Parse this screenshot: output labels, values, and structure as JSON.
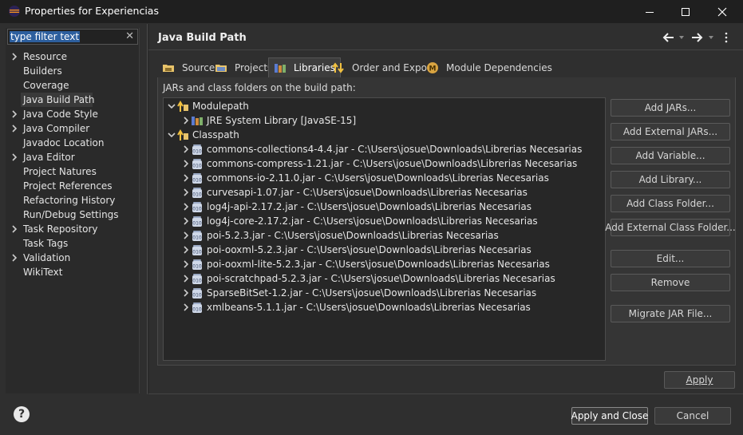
{
  "window": {
    "title": "Properties for Experiencias",
    "minimize_icon": "minimize-icon",
    "maximize_icon": "maximize-icon",
    "close_icon": "close-icon"
  },
  "filter": {
    "value": "type filter text"
  },
  "nav": {
    "items": [
      {
        "label": "Resource",
        "expandable": true
      },
      {
        "label": "Builders",
        "expandable": false
      },
      {
        "label": "Coverage",
        "expandable": false
      },
      {
        "label": "Java Build Path",
        "expandable": false,
        "selected": true
      },
      {
        "label": "Java Code Style",
        "expandable": true
      },
      {
        "label": "Java Compiler",
        "expandable": true
      },
      {
        "label": "Javadoc Location",
        "expandable": false
      },
      {
        "label": "Java Editor",
        "expandable": true
      },
      {
        "label": "Project Natures",
        "expandable": false
      },
      {
        "label": "Project References",
        "expandable": false
      },
      {
        "label": "Refactoring History",
        "expandable": false
      },
      {
        "label": "Run/Debug Settings",
        "expandable": false
      },
      {
        "label": "Task Repository",
        "expandable": true
      },
      {
        "label": "Task Tags",
        "expandable": false
      },
      {
        "label": "Validation",
        "expandable": true
      },
      {
        "label": "WikiText",
        "expandable": false
      }
    ]
  },
  "page": {
    "title": "Java Build Path"
  },
  "tabs": [
    {
      "label": "Source",
      "icon": "source-folder-icon"
    },
    {
      "label": "Projects",
      "icon": "projects-icon"
    },
    {
      "label": "Libraries",
      "icon": "libraries-icon",
      "active": true
    },
    {
      "label": "Order and Export",
      "icon": "order-export-icon"
    },
    {
      "label": "Module Dependencies",
      "icon": "module-icon"
    }
  ],
  "panel": {
    "label": "JARs and class folders on the build path:"
  },
  "tree": {
    "modulepath": {
      "label": "Modulepath",
      "children": [
        "JRE System Library [JavaSE-15]"
      ]
    },
    "classpath": {
      "label": "Classpath",
      "children": [
        "commons-collections4-4.4.jar - C:\\Users\\josue\\Downloads\\Librerias Necesarias",
        "commons-compress-1.21.jar - C:\\Users\\josue\\Downloads\\Librerias Necesarias",
        "commons-io-2.11.0.jar - C:\\Users\\josue\\Downloads\\Librerias Necesarias",
        "curvesapi-1.07.jar - C:\\Users\\josue\\Downloads\\Librerias Necesarias",
        "log4j-api-2.17.2.jar - C:\\Users\\josue\\Downloads\\Librerias Necesarias",
        "log4j-core-2.17.2.jar - C:\\Users\\josue\\Downloads\\Librerias Necesarias",
        "poi-5.2.3.jar - C:\\Users\\josue\\Downloads\\Librerias Necesarias",
        "poi-ooxml-5.2.3.jar - C:\\Users\\josue\\Downloads\\Librerias Necesarias",
        "poi-ooxml-lite-5.2.3.jar - C:\\Users\\josue\\Downloads\\Librerias Necesarias",
        "poi-scratchpad-5.2.3.jar - C:\\Users\\josue\\Downloads\\Librerias Necesarias",
        "SparseBitSet-1.2.jar - C:\\Users\\josue\\Downloads\\Librerias Necesarias",
        "xmlbeans-5.1.1.jar - C:\\Users\\josue\\Downloads\\Librerias Necesarias"
      ]
    }
  },
  "buttons": {
    "add_jars": "Add JARs...",
    "add_external_jars": "Add External JARs...",
    "add_variable": "Add Variable...",
    "add_library": "Add Library...",
    "add_class_folder": "Add Class Folder...",
    "add_external_class_folder": "Add External Class Folder...",
    "edit": "Edit...",
    "remove": "Remove",
    "migrate_jar": "Migrate JAR File...",
    "apply": "Apply",
    "apply_and_close": "Apply and Close",
    "cancel": "Cancel"
  },
  "colors": {
    "background": "#2f2f2f",
    "titlebar": "#1f1f1f",
    "selection": "#2d5f9e",
    "jar_icon": "#cfd8e8",
    "folder_icon": "#e8c36a"
  }
}
